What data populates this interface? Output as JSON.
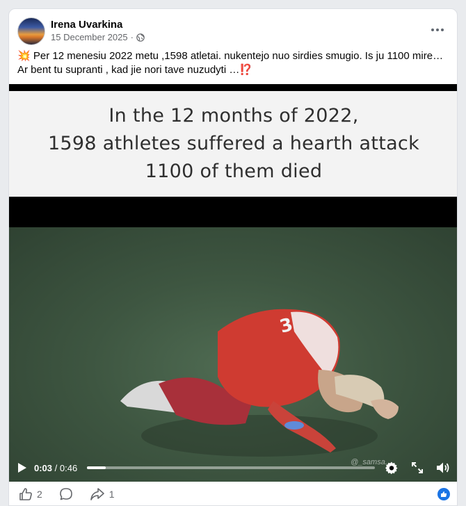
{
  "post": {
    "author": "Irena Uvarkina",
    "date": "15 December 2025",
    "separator": "·",
    "text_line1": "💥 Per 12 menesiu 2022 metu ,1598 atletai. nukentejo nuo sirdies smugio. Is  ju  1100 mire…",
    "text_line2": "Ar bent tu supranti , kad jie nori tave nuzudyti …⁉️"
  },
  "video": {
    "caption_line1": "In the 12 months of 2022,",
    "caption_line2": "1598 athletes suffered a hearth attack",
    "caption_line3": "1100 of them died",
    "current_time": "0:03",
    "time_separator": " / ",
    "duration": "0:46",
    "progress_fraction": 0.065,
    "watermark": "@_samsa..."
  },
  "actions": {
    "like_count": "2",
    "share_count": "1"
  },
  "icons": {
    "globe": "globe-icon",
    "more": "more-options-icon",
    "play": "play-icon",
    "settings": "settings-gear-icon",
    "fullscreen": "fullscreen-icon",
    "volume": "volume-icon",
    "like": "thumbs-up-icon",
    "comment": "comment-icon",
    "share": "share-icon"
  },
  "colors": {
    "facebook_blue": "#1b74e4",
    "secondary_text": "#65676b"
  }
}
